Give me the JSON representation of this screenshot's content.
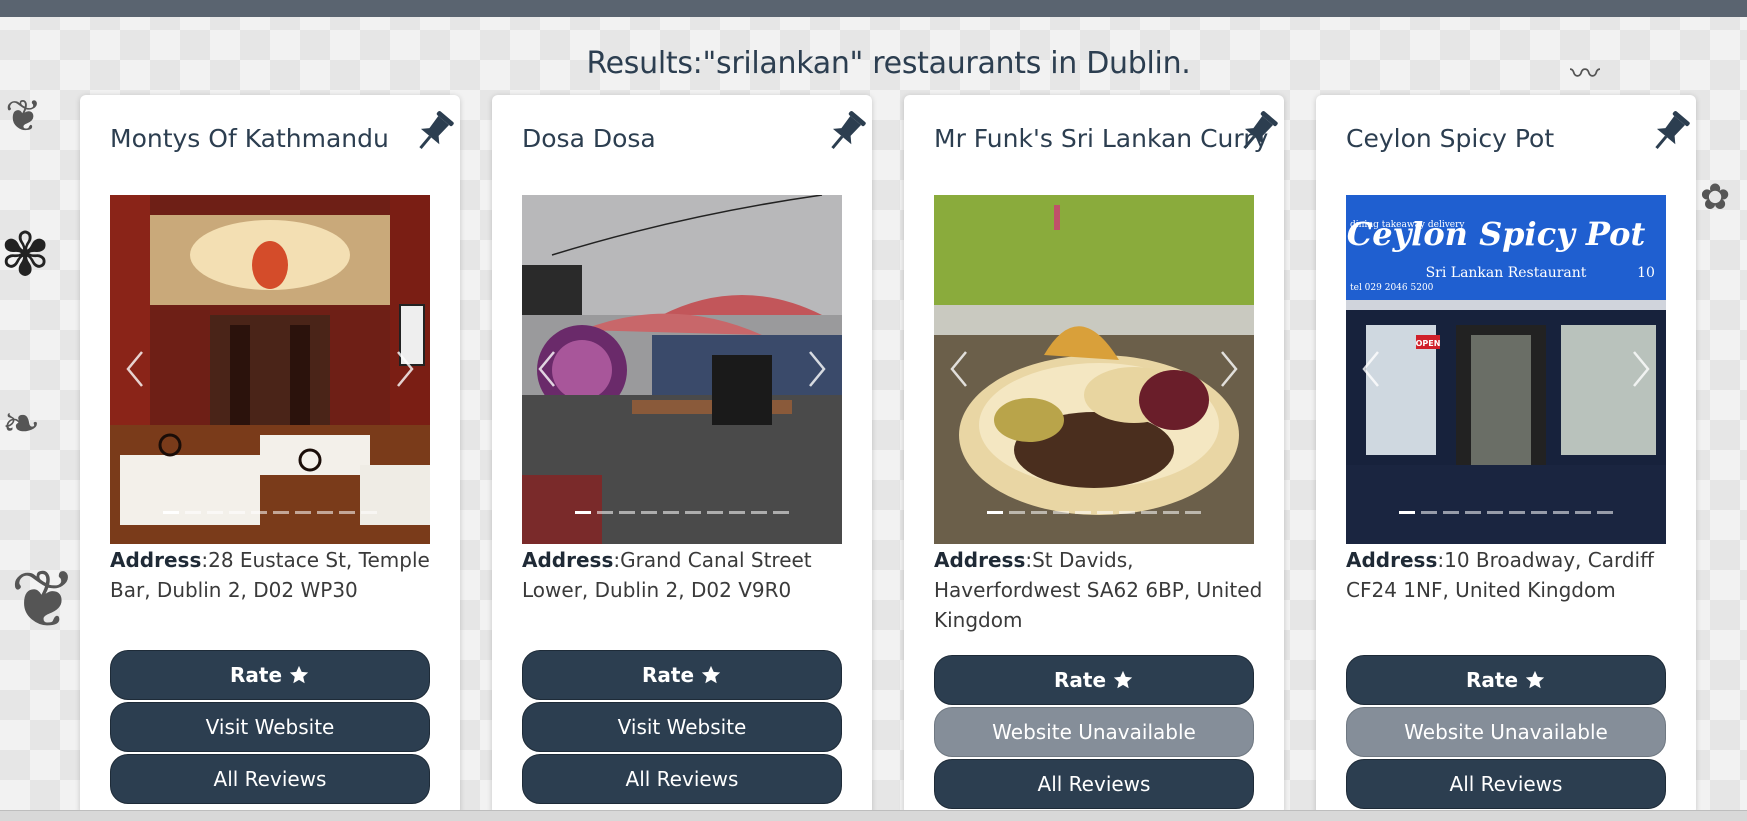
{
  "results_heading": "Results:\"srilankan\" restaurants in Dublin.",
  "cards": [
    {
      "name": "Montys Of Kathmandu",
      "address_label": "Address",
      "address": ":28 Eustace St, Temple Bar, Dublin 2, D02 WP30",
      "rate_label": "Rate",
      "website_label": "Visit Website",
      "website_available": true,
      "reviews_label": "All Reviews",
      "slide_count": 10,
      "active_slide": 1
    },
    {
      "name": "Dosa Dosa",
      "address_label": "Address",
      "address": ":Grand Canal Street Lower, Dublin 2, D02 V9R0",
      "rate_label": "Rate",
      "website_label": "Visit Website",
      "website_available": true,
      "reviews_label": "All Reviews",
      "slide_count": 10,
      "active_slide": 1
    },
    {
      "name": "Mr Funk's Sri Lankan Curry",
      "address_label": "Address",
      "address": ":St Davids, Haverfordwest SA62 6BP, United Kingdom",
      "rate_label": "Rate",
      "website_label": "Website Unavailable",
      "website_available": false,
      "reviews_label": "All Reviews",
      "slide_count": 10,
      "active_slide": 1
    },
    {
      "name": "Ceylon Spicy Pot",
      "address_label": "Address",
      "address": ":10 Broadway, Cardiff CF24 1NF, United Kingdom",
      "rate_label": "Rate",
      "website_label": "Website Unavailable",
      "website_available": false,
      "reviews_label": "All Reviews",
      "slide_count": 10,
      "active_slide": 1
    }
  ],
  "photo_signs": {
    "shop_name": "Ceylon Spicy Pot",
    "shop_sub": "Sri Lankan Restaurant",
    "shop_num": "10",
    "shop_side": "dining takeaway delivery",
    "shop_tel": "tel 029 2046 5200",
    "open_sign": "OPEN"
  },
  "colors": {
    "primary_button": "#2c3e50",
    "disabled_button": "#858e99",
    "heading": "#2c3e50"
  },
  "icons": [
    "pin-icon",
    "star-icon",
    "chevron-left-icon",
    "chevron-right-icon"
  ]
}
